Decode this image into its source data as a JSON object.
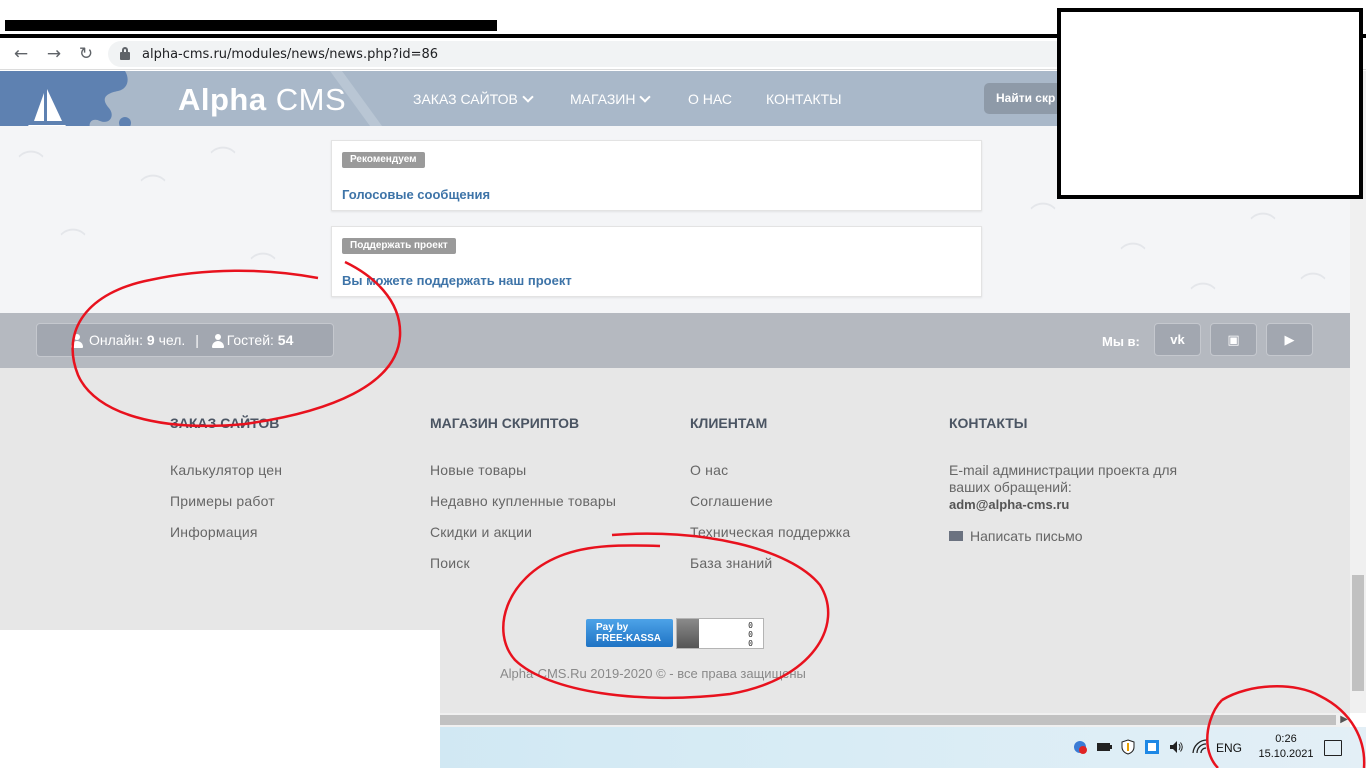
{
  "browser": {
    "url": "alpha-cms.ru/modules/news/news.php?id=86",
    "back_glyph": "←",
    "forward_glyph": "→",
    "reload_glyph": "↻"
  },
  "site": {
    "brand_bold": "Alpha",
    "brand_light": " CMS",
    "nav": [
      {
        "label": "ЗАКАЗ САЙТОВ",
        "has_dropdown": true
      },
      {
        "label": "МАГАЗИН",
        "has_dropdown": true
      },
      {
        "label": "О НАС",
        "has_dropdown": false
      },
      {
        "label": "КОНТАКТЫ",
        "has_dropdown": false
      }
    ],
    "search_button_label": "Найти скр"
  },
  "cards": [
    {
      "badge": "Рекомендуем",
      "link": "Голосовые сообщения"
    },
    {
      "badge": "Поддержать проект",
      "link": "Вы можете поддержать наш проект"
    }
  ],
  "online": {
    "online_label": "Онлайн:",
    "online_count": "9",
    "online_unit": "чел.",
    "separator": "|",
    "guests_label": "Гостей:",
    "guests_count": "54"
  },
  "social": {
    "label": "Мы в:",
    "buttons": [
      {
        "name": "vk",
        "glyph": "vk"
      },
      {
        "name": "instagram",
        "glyph": "▣"
      },
      {
        "name": "youtube",
        "glyph": "▶"
      }
    ]
  },
  "footer": {
    "columns": [
      {
        "title": "ЗАКАЗ САЙТОВ",
        "links": [
          "Калькулятор цен",
          "Примеры работ",
          "Информация"
        ]
      },
      {
        "title": "МАГАЗИН СКРИПТОВ",
        "links": [
          "Новые товары",
          "Недавно купленные товары",
          "Скидки и акции",
          "Поиск"
        ]
      },
      {
        "title": "КЛИЕНТАМ",
        "links": [
          "О нас",
          "Соглашение",
          "Техническая поддержка",
          "База знаний"
        ]
      },
      {
        "title": "КОНТАКТЫ",
        "links": []
      }
    ],
    "contact_description": "E-mail администрации проекта для ваших обращений:",
    "contact_email": "adm@alpha-cms.ru",
    "mail_link": "Написать письмо",
    "pay_badge_line1": "Pay by",
    "pay_badge_line2": "FREE-KASSA",
    "counter_values": [
      "0",
      "0",
      "0"
    ],
    "copyright": "Alpha-CMS.Ru 2019-2020 © - все права защищены"
  },
  "taskbar": {
    "language": "ENG",
    "time": "0:26",
    "date": "15.10.2021"
  },
  "colors": {
    "header_bg": "#a9b8c9",
    "card_link": "#3e74a8",
    "annotation_red": "#e8121e"
  }
}
